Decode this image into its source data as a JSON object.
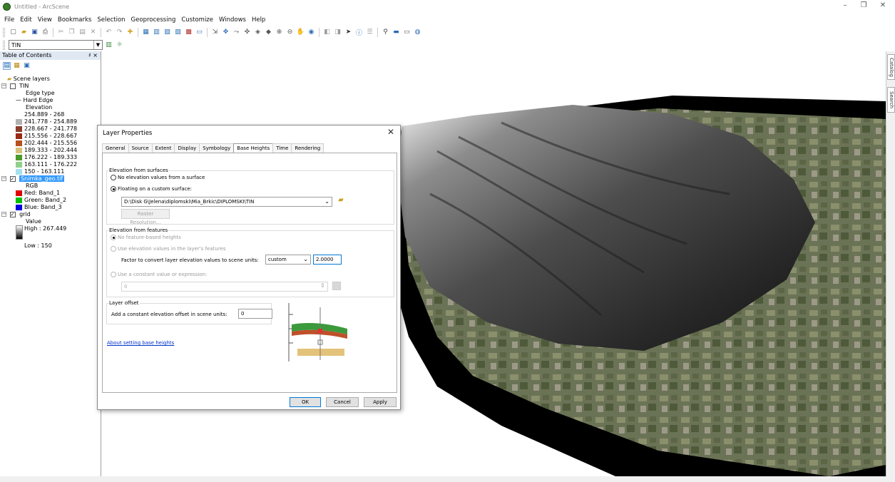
{
  "window": {
    "title": "Untitled - ArcScene",
    "minimize": "–",
    "restore": "❐",
    "close": "✕"
  },
  "menu": [
    "File",
    "Edit",
    "View",
    "Bookmarks",
    "Selection",
    "Geoprocessing",
    "Customize",
    "Windows",
    "Help"
  ],
  "layer_selector": {
    "value": "TIN"
  },
  "toc": {
    "title": "Table of Contents",
    "pin": "♯ ×",
    "scene_layers": "Scene layers",
    "tin": {
      "name": "TIN",
      "edge_type": "Edge type",
      "hard_edge": "Hard Edge",
      "elevation": "Elevation",
      "classes": [
        {
          "label": "254.889 - 268",
          "color": "#ffffff"
        },
        {
          "label": "241.778 - 254.889",
          "color": "#b2b2b2"
        },
        {
          "label": "228.667 - 241.778",
          "color": "#8b3d2a"
        },
        {
          "label": "215.556 - 228.667",
          "color": "#9a2a14"
        },
        {
          "label": "202.444 - 215.556",
          "color": "#b8501e"
        },
        {
          "label": "189.333 - 202.444",
          "color": "#d6c27a"
        },
        {
          "label": "176.222 - 189.333",
          "color": "#4c9b2a"
        },
        {
          "label": "163.111 - 176.222",
          "color": "#8fd08a"
        },
        {
          "label": "150 - 163.111",
          "color": "#a6e0ee"
        }
      ]
    },
    "raster": {
      "name": "Snimka_geo.tif",
      "rgb": "RGB",
      "bands": [
        {
          "label": "Red:   Band_1",
          "color": "#e00000"
        },
        {
          "label": "Green: Band_2",
          "color": "#00c000"
        },
        {
          "label": "Blue:  Band_3",
          "color": "#0000e0"
        }
      ]
    },
    "grid": {
      "name": "grid",
      "value": "Value",
      "high": "High : 267.449",
      "low": "Low : 150"
    }
  },
  "dock_tabs": [
    "Catalog",
    "Search"
  ],
  "dialog": {
    "title": "Layer Properties",
    "tabs": [
      "General",
      "Source",
      "Extent",
      "Display",
      "Symbology",
      "Base Heights",
      "Time",
      "Rendering"
    ],
    "active_tab": "Base Heights",
    "surfaces_group": "Elevation from surfaces",
    "opt_no_surface": "No elevation values from a surface",
    "opt_custom_surface": "Floating on a custom surface:",
    "surface_path": "D:\\Disk G\\Jelena\\diplomski\\Mia_Brkic\\DIPLOMSKI\\TIN",
    "raster_resolution": "Raster Resolution...",
    "features_group": "Elevation from features",
    "opt_no_feature": "No feature-based heights",
    "opt_use_feature": "Use elevation values in the layer's features",
    "factor_label": "Factor to convert layer elevation values to scene units:",
    "factor_unit": "custom",
    "factor_value": "2.0000",
    "opt_constant": "Use a constant value or expression:",
    "constant_value": "0",
    "offset_group": "Layer offset",
    "offset_label": "Add a constant elevation offset in scene units:",
    "offset_value": "0",
    "help_link": "About setting base heights",
    "ok": "OK",
    "cancel": "Cancel",
    "apply": "Apply"
  }
}
